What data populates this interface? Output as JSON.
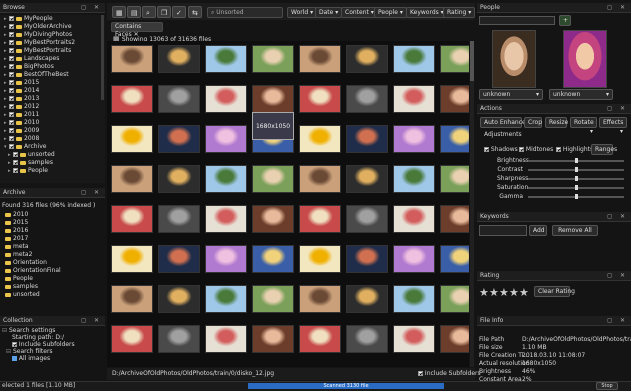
{
  "browse": {
    "title": "Browse",
    "items": [
      {
        "label": "MyPeople",
        "ex": true,
        "cb": "on"
      },
      {
        "label": "MyOlderArchive",
        "ex": true,
        "cb": "on"
      },
      {
        "label": "MyDivingPhotos",
        "ex": true,
        "cb": "on"
      },
      {
        "label": "MyBestPortraits2",
        "ex": true,
        "cb": "on"
      },
      {
        "label": "MyBestPortraits",
        "ex": true,
        "cb": "on"
      },
      {
        "label": "Landscapes",
        "ex": true,
        "cb": "on"
      },
      {
        "label": "BigPhotos",
        "ex": true,
        "cb": "on"
      },
      {
        "label": "BestOfTheBest",
        "ex": true,
        "cb": "on"
      },
      {
        "label": "2015",
        "ex": true,
        "cb": "on"
      },
      {
        "label": "2014",
        "ex": true,
        "cb": "on"
      },
      {
        "label": "2013",
        "ex": true,
        "cb": "on"
      },
      {
        "label": "2012",
        "ex": true,
        "cb": "on"
      },
      {
        "label": "2011",
        "ex": true,
        "cb": "on"
      },
      {
        "label": "2010",
        "ex": true,
        "cb": "on"
      },
      {
        "label": "2009",
        "ex": true,
        "cb": "on"
      },
      {
        "label": "2008",
        "ex": true,
        "cb": "on"
      },
      {
        "label": "Archive",
        "ex": true,
        "cb": "on",
        "open": true
      },
      {
        "label": "unsorted",
        "ex": true,
        "cb": "on",
        "sub": true
      },
      {
        "label": "samples",
        "ex": true,
        "cb": "on",
        "sub": true
      },
      {
        "label": "People",
        "ex": true,
        "cb": "on",
        "sub": true
      }
    ]
  },
  "archive": {
    "title": "Archive",
    "found": "Found 316 files (96% indexed )",
    "items": [
      "2010",
      "2015",
      "2016",
      "2017",
      "meta",
      "meta2",
      "Orientation",
      "OrientationFinal",
      "People",
      "samples",
      "unsorted"
    ]
  },
  "collection": {
    "title": "Collection",
    "search_settings": "Search settings",
    "starting_path": "Starting path: D:/",
    "include_subfolders": "Include Subfolders",
    "search_filters": "Search filters",
    "all_images": "All images"
  },
  "toolbar": {
    "search_placeholder": "Unsorted",
    "filters": [
      "World",
      "Date",
      "Content",
      "People",
      "Keywords",
      "Rating"
    ]
  },
  "center": {
    "tab": "Contains Faces",
    "showing": "Showing 13063 of 31636 files",
    "hover_size": "1680x1050",
    "path": "D:/ArchiveOfOldPhotos/OldPhotos/train/0/disko_12.jpg",
    "include_subfolders": "Include Subfolders"
  },
  "people": {
    "title": "People",
    "plus": "+",
    "faces": [
      {
        "label": "unknown"
      },
      {
        "label": "unknown"
      }
    ]
  },
  "actions": {
    "title": "Actions",
    "buttons": [
      "Auto Enhance",
      "Crop",
      "Resize",
      "Rotate",
      "Effects"
    ],
    "adjustments": "Adjustments",
    "checks": [
      "Shadows",
      "Midtones",
      "Highlights"
    ],
    "ranges": "Ranges",
    "sliders": [
      {
        "label": "Brightness",
        "value": 0.5
      },
      {
        "label": "Contrast",
        "value": 0.5
      },
      {
        "label": "Sharpness",
        "value": 0.5
      },
      {
        "label": "Saturation",
        "value": 0.5
      },
      {
        "label": "Gamma",
        "value": 0.5
      }
    ]
  },
  "keywords": {
    "title": "Keywords",
    "add": "Add",
    "clear": "Remove All"
  },
  "rating": {
    "title": "Rating",
    "stars": 5,
    "clear": "Clear Rating"
  },
  "fileinfo": {
    "title": "File Info",
    "rows": [
      [
        "File Path",
        "D:/ArchiveOfOldPhotos/OldPhotos/train/0/di"
      ],
      [
        "File size",
        "1.10 MB"
      ],
      [
        "File Creation Ti...",
        "2018.03.10 11:08:07"
      ],
      [
        "Actual resolution",
        "1680x1050"
      ],
      [
        "Brightness",
        "46%"
      ],
      [
        "Constant Area",
        "2%"
      ]
    ]
  },
  "status": {
    "left": "elected 1 files [1.10 MB]",
    "center": "Scanned 3130 file",
    "stop": "Stop"
  },
  "colors": {
    "accent": "#2a6cc4",
    "folder": "#e8c54a",
    "bg": "#141414"
  }
}
